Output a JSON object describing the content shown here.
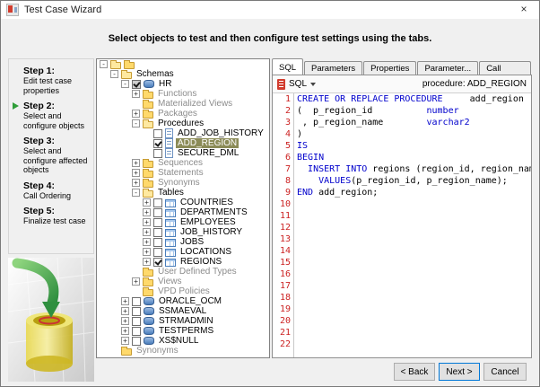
{
  "window": {
    "title": "Test Case Wizard"
  },
  "icons": {
    "close": "×",
    "expand": "+",
    "collapse": "-"
  },
  "header": {
    "instruction": "Select objects to test and then configure test settings using the tabs."
  },
  "steps": {
    "items": [
      {
        "title": "Step 1:",
        "desc": "Edit test case properties",
        "current": false
      },
      {
        "title": "Step 2:",
        "desc": "Select and configure objects",
        "current": true
      },
      {
        "title": "Step 3:",
        "desc": "Select and configure affected objects",
        "current": false
      },
      {
        "title": "Step 4:",
        "desc": "Call Ordering",
        "current": false
      },
      {
        "title": "Step 5:",
        "desc": "Finalize test case",
        "current": false
      }
    ]
  },
  "tree": {
    "nodes": [
      {
        "label": "",
        "level": 0,
        "exp": "collapse",
        "cb": "none",
        "icon": "root",
        "dim": false,
        "sel": false
      },
      {
        "label": "Schemas",
        "level": 1,
        "exp": "collapse",
        "cb": "none",
        "icon": "folder-open",
        "dim": false,
        "sel": false
      },
      {
        "label": "HR",
        "level": 2,
        "exp": "collapse",
        "cb": "mixed",
        "icon": "schema",
        "dim": false,
        "sel": false
      },
      {
        "label": "Functions",
        "level": 3,
        "exp": "expand",
        "cb": "none",
        "icon": "folder",
        "dim": true,
        "sel": false
      },
      {
        "label": "Materialized Views",
        "level": 3,
        "exp": "none",
        "cb": "none",
        "icon": "folder",
        "dim": true,
        "sel": false
      },
      {
        "label": "Packages",
        "level": 3,
        "exp": "expand",
        "cb": "none",
        "icon": "folder",
        "dim": true,
        "sel": false
      },
      {
        "label": "Procedures",
        "level": 3,
        "exp": "collapse",
        "cb": "none",
        "icon": "folder-open",
        "dim": false,
        "sel": false
      },
      {
        "label": "ADD_JOB_HISTORY",
        "level": 4,
        "exp": "none",
        "cb": "off",
        "icon": "procedure",
        "dim": false,
        "sel": false
      },
      {
        "label": "ADD_REGION",
        "level": 4,
        "exp": "none",
        "cb": "on",
        "icon": "procedure",
        "dim": false,
        "sel": true
      },
      {
        "label": "SECURE_DML",
        "level": 4,
        "exp": "none",
        "cb": "off",
        "icon": "procedure",
        "dim": false,
        "sel": false
      },
      {
        "label": "Sequences",
        "level": 3,
        "exp": "expand",
        "cb": "none",
        "icon": "folder",
        "dim": true,
        "sel": false
      },
      {
        "label": "Statements",
        "level": 3,
        "exp": "expand",
        "cb": "none",
        "icon": "folder",
        "dim": true,
        "sel": false
      },
      {
        "label": "Synonyms",
        "level": 3,
        "exp": "expand",
        "cb": "none",
        "icon": "folder",
        "dim": true,
        "sel": false
      },
      {
        "label": "Tables",
        "level": 3,
        "exp": "collapse",
        "cb": "none",
        "icon": "folder-open",
        "dim": false,
        "sel": false
      },
      {
        "label": "COUNTRIES",
        "level": 4,
        "exp": "expand",
        "cb": "off",
        "icon": "table",
        "dim": false,
        "sel": false
      },
      {
        "label": "DEPARTMENTS",
        "level": 4,
        "exp": "expand",
        "cb": "off",
        "icon": "table",
        "dim": false,
        "sel": false
      },
      {
        "label": "EMPLOYEES",
        "level": 4,
        "exp": "expand",
        "cb": "off",
        "icon": "table",
        "dim": false,
        "sel": false
      },
      {
        "label": "JOB_HISTORY",
        "level": 4,
        "exp": "expand",
        "cb": "off",
        "icon": "table",
        "dim": false,
        "sel": false
      },
      {
        "label": "JOBS",
        "level": 4,
        "exp": "expand",
        "cb": "off",
        "icon": "table",
        "dim": false,
        "sel": false
      },
      {
        "label": "LOCATIONS",
        "level": 4,
        "exp": "expand",
        "cb": "off",
        "icon": "table",
        "dim": false,
        "sel": false
      },
      {
        "label": "REGIONS",
        "level": 4,
        "exp": "expand",
        "cb": "on",
        "icon": "table",
        "dim": false,
        "sel": false
      },
      {
        "label": "User Defined Types",
        "level": 3,
        "exp": "none",
        "cb": "none",
        "icon": "folder",
        "dim": true,
        "sel": false
      },
      {
        "label": "Views",
        "level": 3,
        "exp": "expand",
        "cb": "none",
        "icon": "folder",
        "dim": true,
        "sel": false
      },
      {
        "label": "VPD Policies",
        "level": 3,
        "exp": "none",
        "cb": "none",
        "icon": "folder",
        "dim": true,
        "sel": false
      },
      {
        "label": "ORACLE_OCM",
        "level": 2,
        "exp": "expand",
        "cb": "off",
        "icon": "schema",
        "dim": false,
        "sel": false
      },
      {
        "label": "SSMAEVAL",
        "level": 2,
        "exp": "expand",
        "cb": "off",
        "icon": "schema",
        "dim": false,
        "sel": false
      },
      {
        "label": "STRMADMIN",
        "level": 2,
        "exp": "expand",
        "cb": "off",
        "icon": "schema",
        "dim": false,
        "sel": false
      },
      {
        "label": "TESTPERMS",
        "level": 2,
        "exp": "expand",
        "cb": "off",
        "icon": "schema",
        "dim": false,
        "sel": false
      },
      {
        "label": "XS$NULL",
        "level": 2,
        "exp": "expand",
        "cb": "off",
        "icon": "schema",
        "dim": false,
        "sel": false
      },
      {
        "label": "Synonyms",
        "level": 1,
        "exp": "none",
        "cb": "none",
        "icon": "folder",
        "dim": true,
        "sel": false
      }
    ]
  },
  "editor": {
    "tabs": [
      {
        "label": "SQL",
        "active": true
      },
      {
        "label": "Parameters",
        "active": false
      },
      {
        "label": "Properties",
        "active": false
      },
      {
        "label": "Parameter...",
        "active": false
      },
      {
        "label": "Call Values",
        "active": false
      }
    ],
    "toolbar": {
      "dropdown_label": "SQL",
      "object_label": "procedure: ADD_REGION"
    },
    "lines": [
      {
        "n": "1",
        "segs": [
          {
            "c": "kw",
            "t": "CREATE OR REPLACE PROCEDURE"
          },
          {
            "c": "id",
            "t": "     add_region"
          }
        ]
      },
      {
        "n": "2",
        "segs": [
          {
            "c": "id",
            "t": "(  p_region_id          "
          },
          {
            "c": "kw",
            "t": "number"
          }
        ]
      },
      {
        "n": "3",
        "segs": [
          {
            "c": "id",
            "t": " , p_region_name        "
          },
          {
            "c": "kw",
            "t": "varchar2"
          }
        ]
      },
      {
        "n": "4",
        "segs": [
          {
            "c": "id",
            "t": ")"
          }
        ]
      },
      {
        "n": "5",
        "segs": [
          {
            "c": "kw",
            "t": "IS"
          }
        ]
      },
      {
        "n": "6",
        "segs": [
          {
            "c": "kw",
            "t": "BEGIN"
          }
        ]
      },
      {
        "n": "7",
        "segs": [
          {
            "c": "id",
            "t": "  "
          },
          {
            "c": "kw",
            "t": "INSERT INTO"
          },
          {
            "c": "id",
            "t": " regions (region_id, region_name)"
          }
        ]
      },
      {
        "n": "8",
        "segs": [
          {
            "c": "id",
            "t": "    "
          },
          {
            "c": "kw",
            "t": "VALUES"
          },
          {
            "c": "id",
            "t": "(p_region_id, p_region_name);"
          }
        ]
      },
      {
        "n": "9",
        "segs": [
          {
            "c": "kw",
            "t": "END"
          },
          {
            "c": "id",
            "t": " add_region;"
          }
        ]
      },
      {
        "n": "10",
        "segs": []
      },
      {
        "n": "11",
        "segs": []
      },
      {
        "n": "12",
        "segs": []
      },
      {
        "n": "13",
        "segs": []
      },
      {
        "n": "14",
        "segs": []
      },
      {
        "n": "15",
        "segs": []
      },
      {
        "n": "16",
        "segs": []
      },
      {
        "n": "17",
        "segs": []
      },
      {
        "n": "18",
        "segs": []
      },
      {
        "n": "19",
        "segs": []
      },
      {
        "n": "20",
        "segs": []
      },
      {
        "n": "21",
        "segs": []
      },
      {
        "n": "22",
        "segs": []
      }
    ]
  },
  "footer": {
    "back": "< Back",
    "next": "Next >",
    "cancel": "Cancel"
  },
  "colors": {
    "selection": "#8b8b57",
    "keyword": "#0000cc",
    "line_number": "#cc2222",
    "step_arrow_green": "#2f9e39"
  }
}
